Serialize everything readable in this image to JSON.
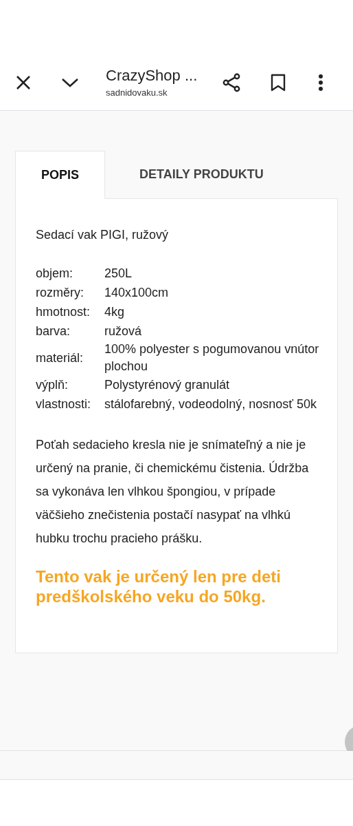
{
  "toolbar": {
    "title": "CrazyShop ...",
    "url": "sadnidovaku.sk"
  },
  "tabs": [
    {
      "label": "POPIS",
      "selected": true
    },
    {
      "label": "DETAILY PRODUKTU",
      "selected": false
    }
  ],
  "description": {
    "title": "Sedací vak PIGI, ružový",
    "specs": [
      {
        "name": "objem:",
        "value": [
          "250L"
        ]
      },
      {
        "name": "rozměry:",
        "value": [
          "140x100cm"
        ]
      },
      {
        "name": "hmotnost:",
        "value": [
          "4kg"
        ]
      },
      {
        "name": "barva:",
        "value": [
          "ružová"
        ]
      },
      {
        "name": "materiál:",
        "value": [
          "100% polyester s pogumovanou vnútor",
          "plochou"
        ]
      },
      {
        "name": "výplň:",
        "value": [
          "Polystyrénový granulát"
        ]
      },
      {
        "name": "vlastnosti:",
        "value": [
          "stálofarebný, vodeodolný, nosnosť 50k"
        ]
      }
    ],
    "paragraph": "Poťah sedacieho kresla nie je snímateľný a nie je určený na pranie, či chemickému čistenia. Údržba sa vykonáva len vlhkou špongiou, v prípade väčšieho znečistenia postačí nasypať na vlhkú hubku trochu pracieho prášku.",
    "notice": "Tento vak je určený len pre deti predškolského veku do 50kg."
  }
}
